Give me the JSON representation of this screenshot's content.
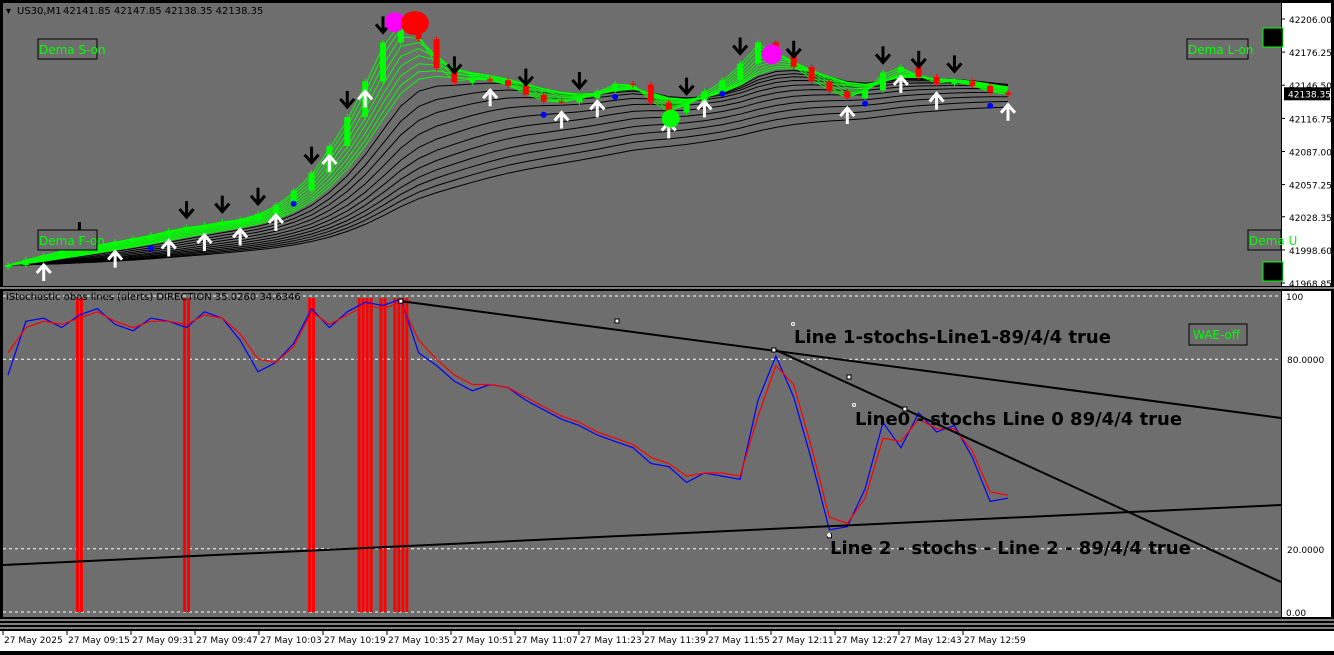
{
  "colors": {
    "background": "#6e6e6e",
    "frame": "#000000",
    "bull_candle": "#00ff00",
    "bear_candle": "#ff0000",
    "upper_band": "#00ff00",
    "lower_band": "#000000",
    "stoch_main": "#0000ff",
    "stoch_signal": "#ff0000",
    "histogram": "#ff0000",
    "button_text": "#00ff00",
    "price_tag_bg": "#000000",
    "price_tag_text": "#ffffff"
  },
  "header": {
    "symbol": "US30,M1",
    "ohlc": "42141.85 42147.85 42138.35 42138.35"
  },
  "buttons": {
    "dema_s": "Dema S-on",
    "dema_l": "Dema L-on",
    "dema_f": "Dema F-on",
    "dema_u": "Dema U",
    "wae": "WAE-off"
  },
  "price_scale": {
    "labels": [
      "42206.00",
      "42176.25",
      "42146.50",
      "42116.75",
      "42087.00",
      "42057.25",
      "42028.35",
      "41998.60",
      "41968.85"
    ],
    "current": "42138.35"
  },
  "indicator": {
    "title": "iStochastic obos lines (alerts) DIRECTION 35.0260 34.6346",
    "scale_labels": [
      "100",
      "80.0000",
      "20.0000",
      "0.00"
    ]
  },
  "trendlines": {
    "line1": "Line 1-stochs-Line1-89/4/4 true",
    "line0": "Line0 - stochs Line 0 89/4/4 true",
    "line2": "Line 2 - stochs - Line 2 - 89/4/4 true"
  },
  "time_axis": {
    "labels": [
      "27 May 2025",
      "27 May 09:15",
      "27 May 09:31",
      "27 May 09:47",
      "27 May 10:03",
      "27 May 10:19",
      "27 May 10:35",
      "27 May 10:51",
      "27 May 11:07",
      "27 May 11:23",
      "27 May 11:39",
      "27 May 11:55",
      "27 May 12:11",
      "27 May 12:27",
      "27 May 12:43",
      "27 May 12:59"
    ]
  },
  "chart_data": [
    {
      "type": "line",
      "name": "US30,M1 price",
      "ylim": [
        41968.85,
        42206.0
      ],
      "y_tick_labels": [
        "42206.00",
        "42176.25",
        "42146.50",
        "42116.75",
        "42087.00",
        "42057.25",
        "42028.35",
        "41998.60",
        "41968.85"
      ],
      "x_tick_labels": [
        "27 May 2025",
        "27 May 09:15",
        "27 May 09:31",
        "27 May 09:47",
        "27 May 10:03",
        "27 May 10:19",
        "27 May 10:35",
        "27 May 10:51",
        "27 May 11:07",
        "27 May 11:23",
        "27 May 11:39",
        "27 May 11:55",
        "27 May 12:11",
        "27 May 12:27",
        "27 May 12:43",
        "27 May 12:59"
      ],
      "close_series": [
        41985,
        41990,
        41994,
        41998,
        42000,
        42003,
        42006,
        42009,
        42012,
        42016,
        42019,
        42021,
        42024,
        42026,
        42031,
        42039,
        42052,
        42068,
        42092,
        42118,
        42150,
        42185,
        42205,
        42188,
        42162,
        42149,
        42152,
        42151,
        42146,
        42138,
        42132,
        42131,
        42135,
        42141,
        42148,
        42147,
        42131,
        42122,
        42130,
        42141,
        42151,
        42166,
        42185,
        42176,
        42163,
        42150,
        42141,
        42135,
        42142,
        42158,
        42163,
        42154,
        42148,
        42150,
        42146,
        42140,
        42138
      ],
      "current": 42138.35
    },
    {
      "type": "line",
      "name": "iStochastic obos lines (alerts)",
      "ylim": [
        0,
        100
      ],
      "y_tick_labels": [
        "100",
        "80.0000",
        "20.0000",
        "0.00"
      ],
      "levels": [
        100,
        80,
        20,
        0
      ],
      "series": [
        {
          "name": "main",
          "values": [
            75,
            92,
            93,
            90,
            94,
            96,
            91,
            89,
            93,
            92,
            90,
            95,
            93,
            86,
            76,
            79,
            85,
            96,
            90,
            95,
            98,
            97,
            99,
            82,
            78,
            73,
            70,
            72,
            71,
            67,
            64,
            61,
            59,
            56,
            54,
            52,
            47,
            46,
            41,
            44,
            43,
            42,
            67,
            81,
            68,
            48,
            26,
            27,
            39,
            60,
            52,
            63,
            57,
            59,
            49,
            35,
            36
          ]
        },
        {
          "name": "signal",
          "values": [
            82,
            90,
            92,
            91,
            93,
            95,
            92,
            90,
            92,
            92,
            91,
            94,
            93,
            88,
            80,
            79,
            84,
            95,
            91,
            94,
            97,
            96,
            98,
            86,
            80,
            75,
            72,
            72,
            71,
            68,
            65,
            62,
            60,
            57,
            55,
            53,
            49,
            47,
            43,
            44,
            44,
            43,
            62,
            78,
            72,
            52,
            30,
            28,
            36,
            55,
            54,
            61,
            58,
            58,
            51,
            38,
            37
          ]
        }
      ],
      "direction_values": [
        35.026,
        34.6346
      ]
    }
  ]
}
